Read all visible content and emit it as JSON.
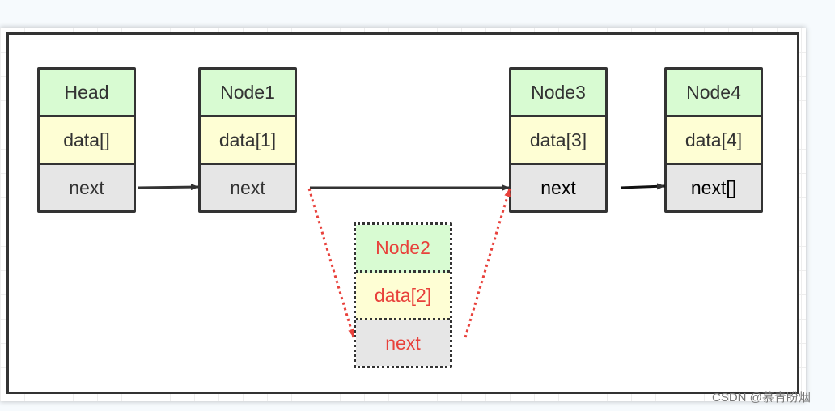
{
  "nodes": [
    {
      "id": "head",
      "title": "Head",
      "data": "data[]",
      "next": "next"
    },
    {
      "id": "node1",
      "title": "Node1",
      "data": "data[1]",
      "next": "next"
    },
    {
      "id": "node3",
      "title": "Node3",
      "data": "data[3]",
      "next": "next"
    },
    {
      "id": "node4",
      "title": "Node4",
      "data": "data[4]",
      "next": "next[]"
    },
    {
      "id": "node2",
      "title": "Node2",
      "data": "data[2]",
      "next": "next"
    }
  ],
  "colors": {
    "title_fill": "#d8fbd2",
    "data_fill": "#fefed4",
    "next_fill": "#e6e6e6",
    "border": "#333333",
    "removed_text": "#e8413b",
    "removed_arrow": "#e8413b"
  },
  "edges": [
    {
      "from": "head",
      "to": "node1",
      "style": "solid"
    },
    {
      "from": "node1",
      "to": "node3",
      "style": "solid"
    },
    {
      "from": "node3",
      "to": "node4",
      "style": "solid"
    },
    {
      "from": "node1",
      "to": "node2",
      "style": "dotted-red"
    },
    {
      "from": "node2",
      "to": "node3",
      "style": "dotted-red"
    }
  ],
  "watermark": "CSDN @慕青盼烟"
}
